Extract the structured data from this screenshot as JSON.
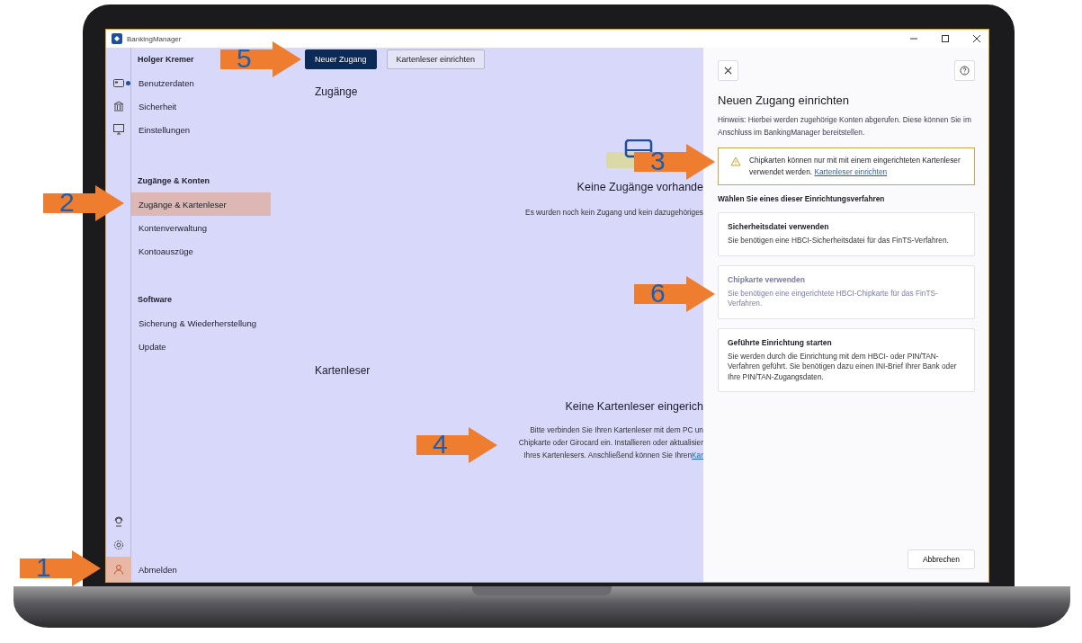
{
  "window": {
    "title": "BankingManager"
  },
  "toolbar": {
    "buttons": [
      {
        "label": "Neuer Zugang",
        "kind": "primary"
      },
      {
        "label": "Kartenleser einrichten",
        "kind": "secondary"
      }
    ]
  },
  "sidebar": {
    "sections": [
      {
        "heading": "Holger Kremer",
        "items": [
          {
            "label": "Benutzerdaten",
            "selected": false,
            "dot": true
          },
          {
            "label": "Sicherheit",
            "selected": false,
            "dot": false
          },
          {
            "label": "Einstellungen",
            "selected": false,
            "dot": false
          }
        ]
      },
      {
        "heading": "Zugänge & Konten",
        "items": [
          {
            "label": "Zugänge & Kartenleser",
            "selected": true,
            "dot": false
          },
          {
            "label": "Kontenverwaltung",
            "selected": false,
            "dot": false
          },
          {
            "label": "Kontoauszüge",
            "selected": false,
            "dot": false
          }
        ]
      },
      {
        "heading": "Software",
        "items": [
          {
            "label": "Sicherung & Wiederherstellung",
            "selected": false,
            "dot": false
          },
          {
            "label": "Update",
            "selected": false,
            "dot": false
          }
        ]
      }
    ],
    "logout": {
      "label": "Abmelden",
      "selected": true
    }
  },
  "main": {
    "sections": [
      {
        "title": "Zugänge",
        "empty_title": "Keine Zugänge vorhande",
        "lines": [
          "Es wurden noch kein Zugang und kein dazugehöriges"
        ]
      },
      {
        "title": "Kartenleser",
        "empty_title": "Keine Kartenleser eingerich",
        "lines": [
          "Bitte verbinden Sie Ihren Kartenleser mit dem PC un",
          "Chipkarte oder Girocard ein. Installieren oder aktualisier",
          "Ihres Kartenlesers. Anschließend können Sie Ihren"
        ],
        "link": "Kar"
      }
    ]
  },
  "panel": {
    "title": "Neuen Zugang einrichten",
    "hint": "Hinweis: Hierbei werden zugehörige Konten abgerufen. Diese können Sie im Anschluss im BankingManager bereitstellen.",
    "warning": {
      "text": "Chipkarten können nur mit mit einem eingerichteten Kartenleser verwendet werden.",
      "link": "Kartenleser einrichten"
    },
    "choose_label": "Wählen Sie eines dieser Einrichtungsverfahren",
    "options": [
      {
        "title": "Sicherheitsdatei verwenden",
        "description": "Sie benötigen eine HBCI-Sicherheitsdatei für das FinTS-Verfahren.",
        "disabled": false
      },
      {
        "title": "Chipkarte verwenden",
        "description": "Sie benötigen eine eingerichtete HBCI-Chipkarte für das FinTS-Verfahren.",
        "disabled": true
      },
      {
        "title": "Geführte Einrichtung starten",
        "description": "Sie werden durch die Einrichtung mit dem HBCI- oder PIN/TAN-Verfahren geführt. Sie benötigen dazu einen INI-Brief Ihrer Bank oder Ihre PIN/TAN-Zugangsdaten.",
        "disabled": false
      }
    ],
    "cancel": "Abbrechen"
  },
  "callouts": [
    {
      "number": "1"
    },
    {
      "number": "2"
    },
    {
      "number": "3"
    },
    {
      "number": "4"
    },
    {
      "number": "5"
    },
    {
      "number": "6"
    }
  ]
}
